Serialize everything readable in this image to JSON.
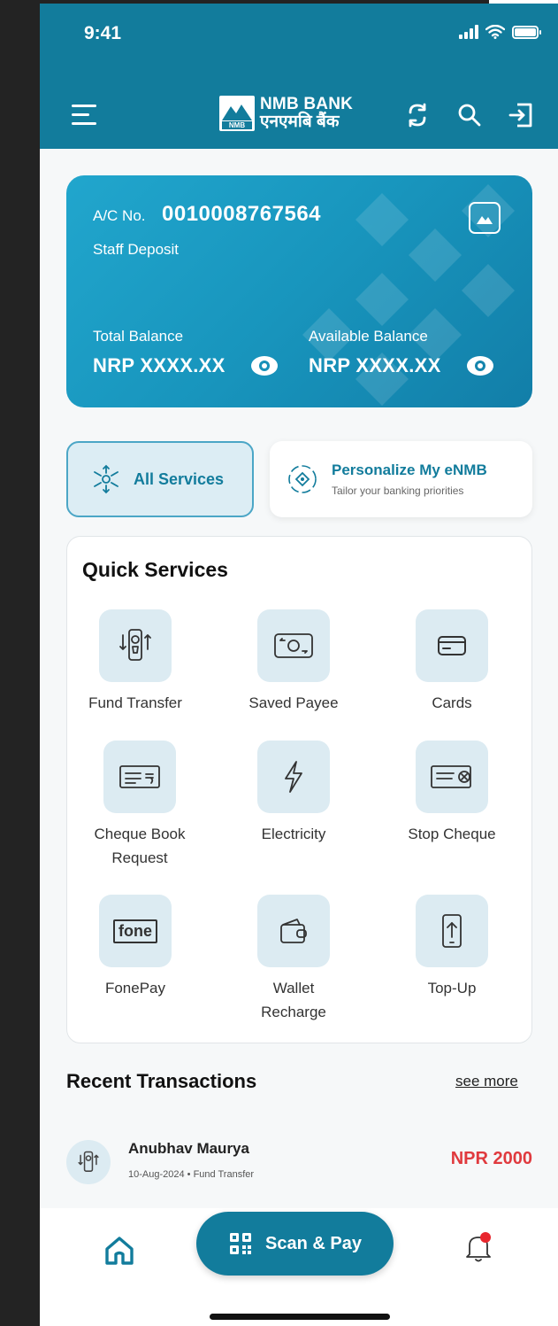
{
  "status_bar": {
    "time": "9:41"
  },
  "header": {
    "brand_en": "NMB BANK",
    "brand_np": "एनएमबि बैंक",
    "logo_text": "NMB"
  },
  "account": {
    "label": "A/C No.",
    "number": "0010008767564",
    "type": "Staff Deposit",
    "total_balance_label": "Total Balance",
    "total_balance_value": "NRP XXXX.XX",
    "available_balance_label": "Available Balance",
    "available_balance_value": "NRP XXXX.XX"
  },
  "services": {
    "all_services_label": "All Services",
    "personalize_title": "Personalize My eNMB",
    "personalize_subtitle": "Tailor your banking priorities"
  },
  "quick_services": {
    "title": "Quick Services",
    "items": [
      {
        "label": "Fund Transfer",
        "icon": "phone-transfer-icon"
      },
      {
        "label": "Saved Payee",
        "icon": "cash-transfer-icon"
      },
      {
        "label": "Cards",
        "icon": "card-icon"
      },
      {
        "label": "Cheque Book\nRequest",
        "icon": "cheque-icon"
      },
      {
        "label": "Electricity",
        "icon": "lightning-icon"
      },
      {
        "label": "Stop Cheque",
        "icon": "stop-cheque-icon"
      },
      {
        "label": "FonePay",
        "icon": "fonepay-icon",
        "icon_text": "fone"
      },
      {
        "label": "Wallet\nRecharge",
        "icon": "wallet-icon"
      },
      {
        "label": "Top-Up",
        "icon": "mobile-topup-icon"
      }
    ]
  },
  "recent_transactions": {
    "title": "Recent Transactions",
    "see_more": "see more",
    "items": [
      {
        "name": "Anubhav Maurya",
        "meta": "10-Aug-2024 • Fund Transfer",
        "amount": "NPR 2000"
      }
    ]
  },
  "bottom_nav": {
    "scan_pay_label": "Scan & Pay"
  },
  "colors": {
    "primary": "#127c9c",
    "card_gradient_start": "#21a6cd",
    "tile_bg": "#dcebf2",
    "debit_red": "#e03a3e",
    "notification_dot": "#e8262d"
  }
}
